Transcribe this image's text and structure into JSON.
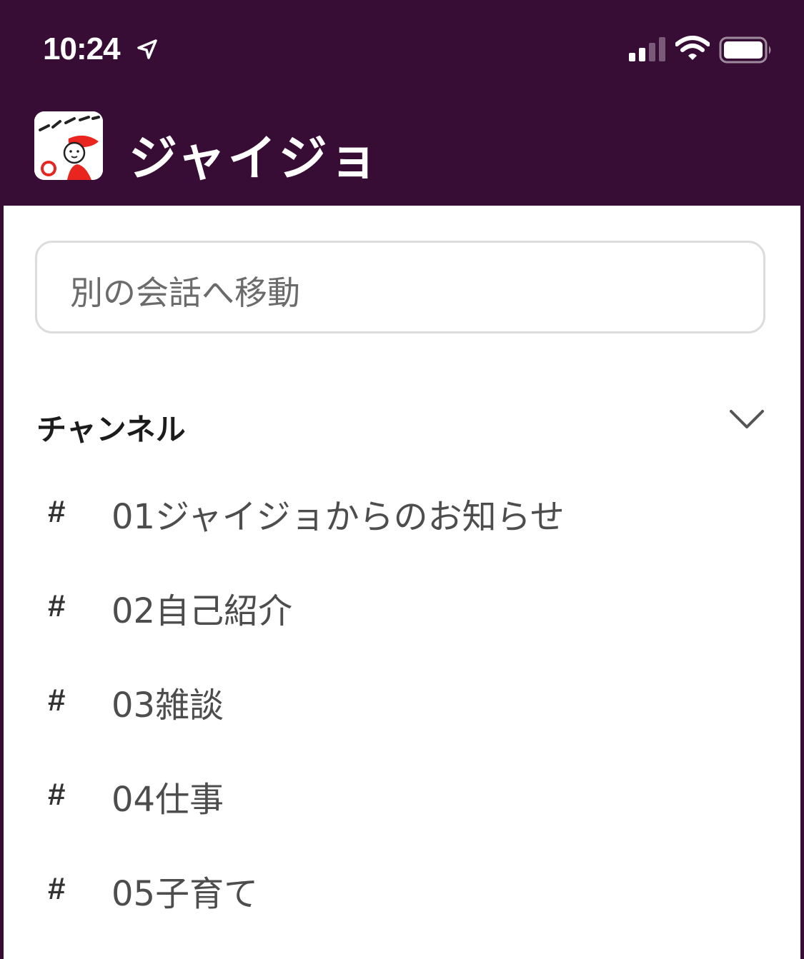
{
  "status_bar": {
    "time": "10:24",
    "icons": [
      "location-arrow-icon",
      "cellular-signal-icon",
      "wifi-icon",
      "battery-icon"
    ]
  },
  "header": {
    "workspace_name": "ジャイジョ",
    "logo_icon": "workspace-logo"
  },
  "search": {
    "placeholder": "別の会話へ移動"
  },
  "channels": {
    "section_title": "チャンネル",
    "collapse_icon": "chevron-down-icon",
    "items": [
      {
        "hash": "#",
        "name": "01ジャイジョからのお知らせ"
      },
      {
        "hash": "#",
        "name": "02自己紹介"
      },
      {
        "hash": "#",
        "name": "03雑談"
      },
      {
        "hash": "#",
        "name": "04仕事"
      },
      {
        "hash": "#",
        "name": "05子育て"
      }
    ]
  },
  "colors": {
    "header_bg": "#380d35",
    "panel_bg": "#ffffff",
    "text_primary": "#1d1c1d",
    "text_secondary": "#4d4d4d",
    "logo_accent": "#e8251f"
  }
}
